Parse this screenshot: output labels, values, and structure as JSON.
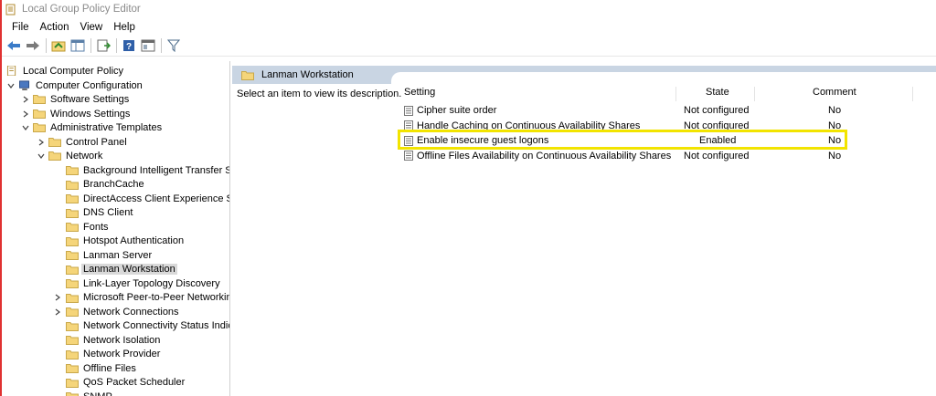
{
  "window": {
    "title": "Local Group Policy Editor"
  },
  "menu": [
    "File",
    "Action",
    "View",
    "Help"
  ],
  "toolbar": {
    "icons": [
      "back-arrow-icon",
      "forward-arrow-icon",
      "up-folder-icon",
      "show-hide-tree-icon",
      "export-list-icon",
      "help-icon",
      "properties-pane-icon",
      "filter-icon"
    ]
  },
  "tree": {
    "root": "Local Computer Policy",
    "computer_config": "Computer Configuration",
    "software_settings": "Software Settings",
    "windows_settings": "Windows Settings",
    "admin_templates": "Administrative Templates",
    "control_panel": "Control Panel",
    "network": "Network",
    "network_children": [
      "Background Intelligent Transfer Ser",
      "BranchCache",
      "DirectAccess Client Experience Sett",
      "DNS Client",
      "Fonts",
      "Hotspot Authentication",
      "Lanman Server",
      "Lanman Workstation",
      "Link-Layer Topology Discovery",
      "Microsoft Peer-to-Peer Networking",
      "Network Connections",
      "Network Connectivity Status Indica",
      "Network Isolation",
      "Network Provider",
      "Offline Files",
      "QoS Packet Scheduler",
      "SNMP"
    ],
    "selected": "Lanman Workstation"
  },
  "details": {
    "header": "Lanman Workstation",
    "description": "Select an item to view its description.",
    "columns": {
      "setting": "Setting",
      "state": "State",
      "comment": "Comment"
    },
    "rows": [
      {
        "setting": "Cipher suite order",
        "state": "Not configured",
        "comment": "No"
      },
      {
        "setting": "Handle Caching on Continuous Availability Shares",
        "state": "Not configured",
        "comment": "No"
      },
      {
        "setting": "Enable insecure guest logons",
        "state": "Enabled",
        "comment": "No"
      },
      {
        "setting": "Offline Files Availability on Continuous Availability Shares",
        "state": "Not configured",
        "comment": "No"
      }
    ],
    "highlighted_row": "Enable insecure guest logons"
  },
  "colors": {
    "header_bg": "#c9d5e3",
    "highlight": "#f2e400",
    "selection": "#d9d9d9",
    "folder": "#f5d57a"
  }
}
